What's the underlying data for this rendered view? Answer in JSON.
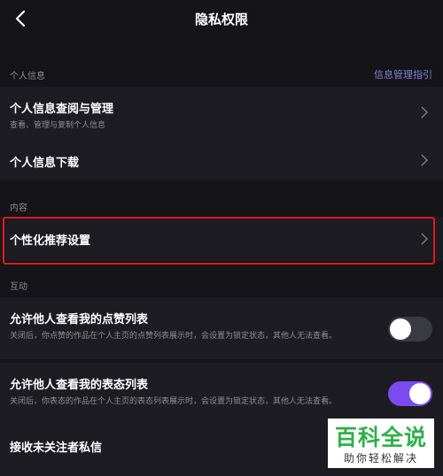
{
  "header": {
    "title": "隐私权限",
    "back_icon": "chevron-left-icon"
  },
  "personal_info": {
    "label": "个人信息",
    "link": "信息管理指引",
    "items": [
      {
        "title": "个人信息查阅与管理",
        "subtitle": "查看、管理与复制个人信息"
      },
      {
        "title": "个人信息下载",
        "subtitle": ""
      }
    ]
  },
  "content": {
    "label": "内容",
    "items": [
      {
        "title": "个性化推荐设置"
      }
    ]
  },
  "interaction": {
    "label": "互动",
    "items": [
      {
        "title": "允许他人查看我的点赞列表",
        "subtitle": "关闭后，你点赞的作品在个人主页的点赞列表展示时，会设置为锁定状态，其他人无法查看。",
        "toggle": "off"
      },
      {
        "title": "允许他人查看我的表态列表",
        "subtitle": "关闭后，你表态的作品在个人主页的表态列表展示时，会设置为锁定状态，其他人无法查看。",
        "toggle": "on"
      },
      {
        "title": "接收未关注者私信"
      }
    ]
  },
  "watermark": {
    "brand": "百科全说",
    "slogan": "助你轻松解决"
  },
  "colors": {
    "background": "#141419",
    "row": "#1c1c22",
    "accent": "#7a4cf0",
    "link": "#7d84d4",
    "highlight": "#e01a1a"
  }
}
